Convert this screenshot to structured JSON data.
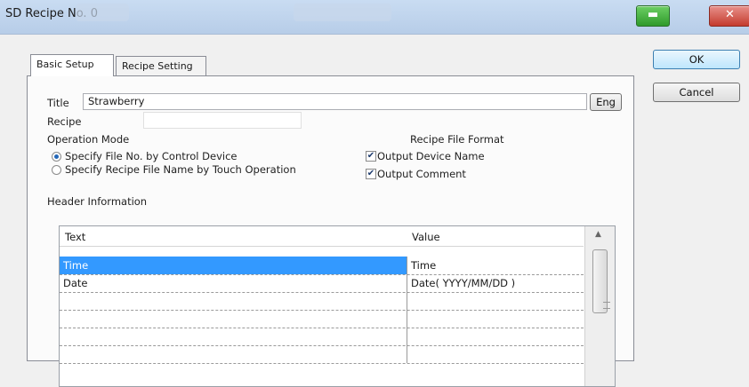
{
  "window": {
    "title": "SD Recipe No. 0"
  },
  "tabs": [
    {
      "label": "Basic Setup",
      "active": true
    },
    {
      "label": "Recipe Setting",
      "active": false
    }
  ],
  "dialog_buttons": {
    "ok": "OK",
    "cancel": "Cancel"
  },
  "form": {
    "title_label": "Title",
    "title_value": "Strawberry",
    "eng_button": "Eng",
    "recipe_label": "Recipe",
    "recipe_value": "",
    "operation_mode_label": "Operation Mode",
    "mode_options": [
      {
        "label": "Specify File No. by Control Device",
        "selected": true
      },
      {
        "label": "Specify Recipe File Name by Touch Operation",
        "selected": false
      }
    ],
    "file_format_label": "Recipe File Format",
    "format_options": [
      {
        "label": "Output Device Name",
        "checked": true
      },
      {
        "label": "Output Comment",
        "checked": true
      }
    ],
    "header_info_label": "Header Information"
  },
  "table": {
    "columns": [
      "Text",
      "Value"
    ],
    "rows": [
      {
        "text": "Time",
        "value": "Time",
        "selected": true
      },
      {
        "text": "Date",
        "value": "Date( YYYY/MM/DD )",
        "selected": false
      },
      {
        "text": "",
        "value": ""
      },
      {
        "text": "",
        "value": ""
      },
      {
        "text": "",
        "value": ""
      },
      {
        "text": "",
        "value": ""
      }
    ]
  },
  "colors": {
    "selection": "#3399ff",
    "titlebar": "#c9dcf2",
    "close": "#c43b2e"
  },
  "icons": {
    "minimize": "minimize-icon",
    "close": "close-icon",
    "check": "check-icon"
  }
}
